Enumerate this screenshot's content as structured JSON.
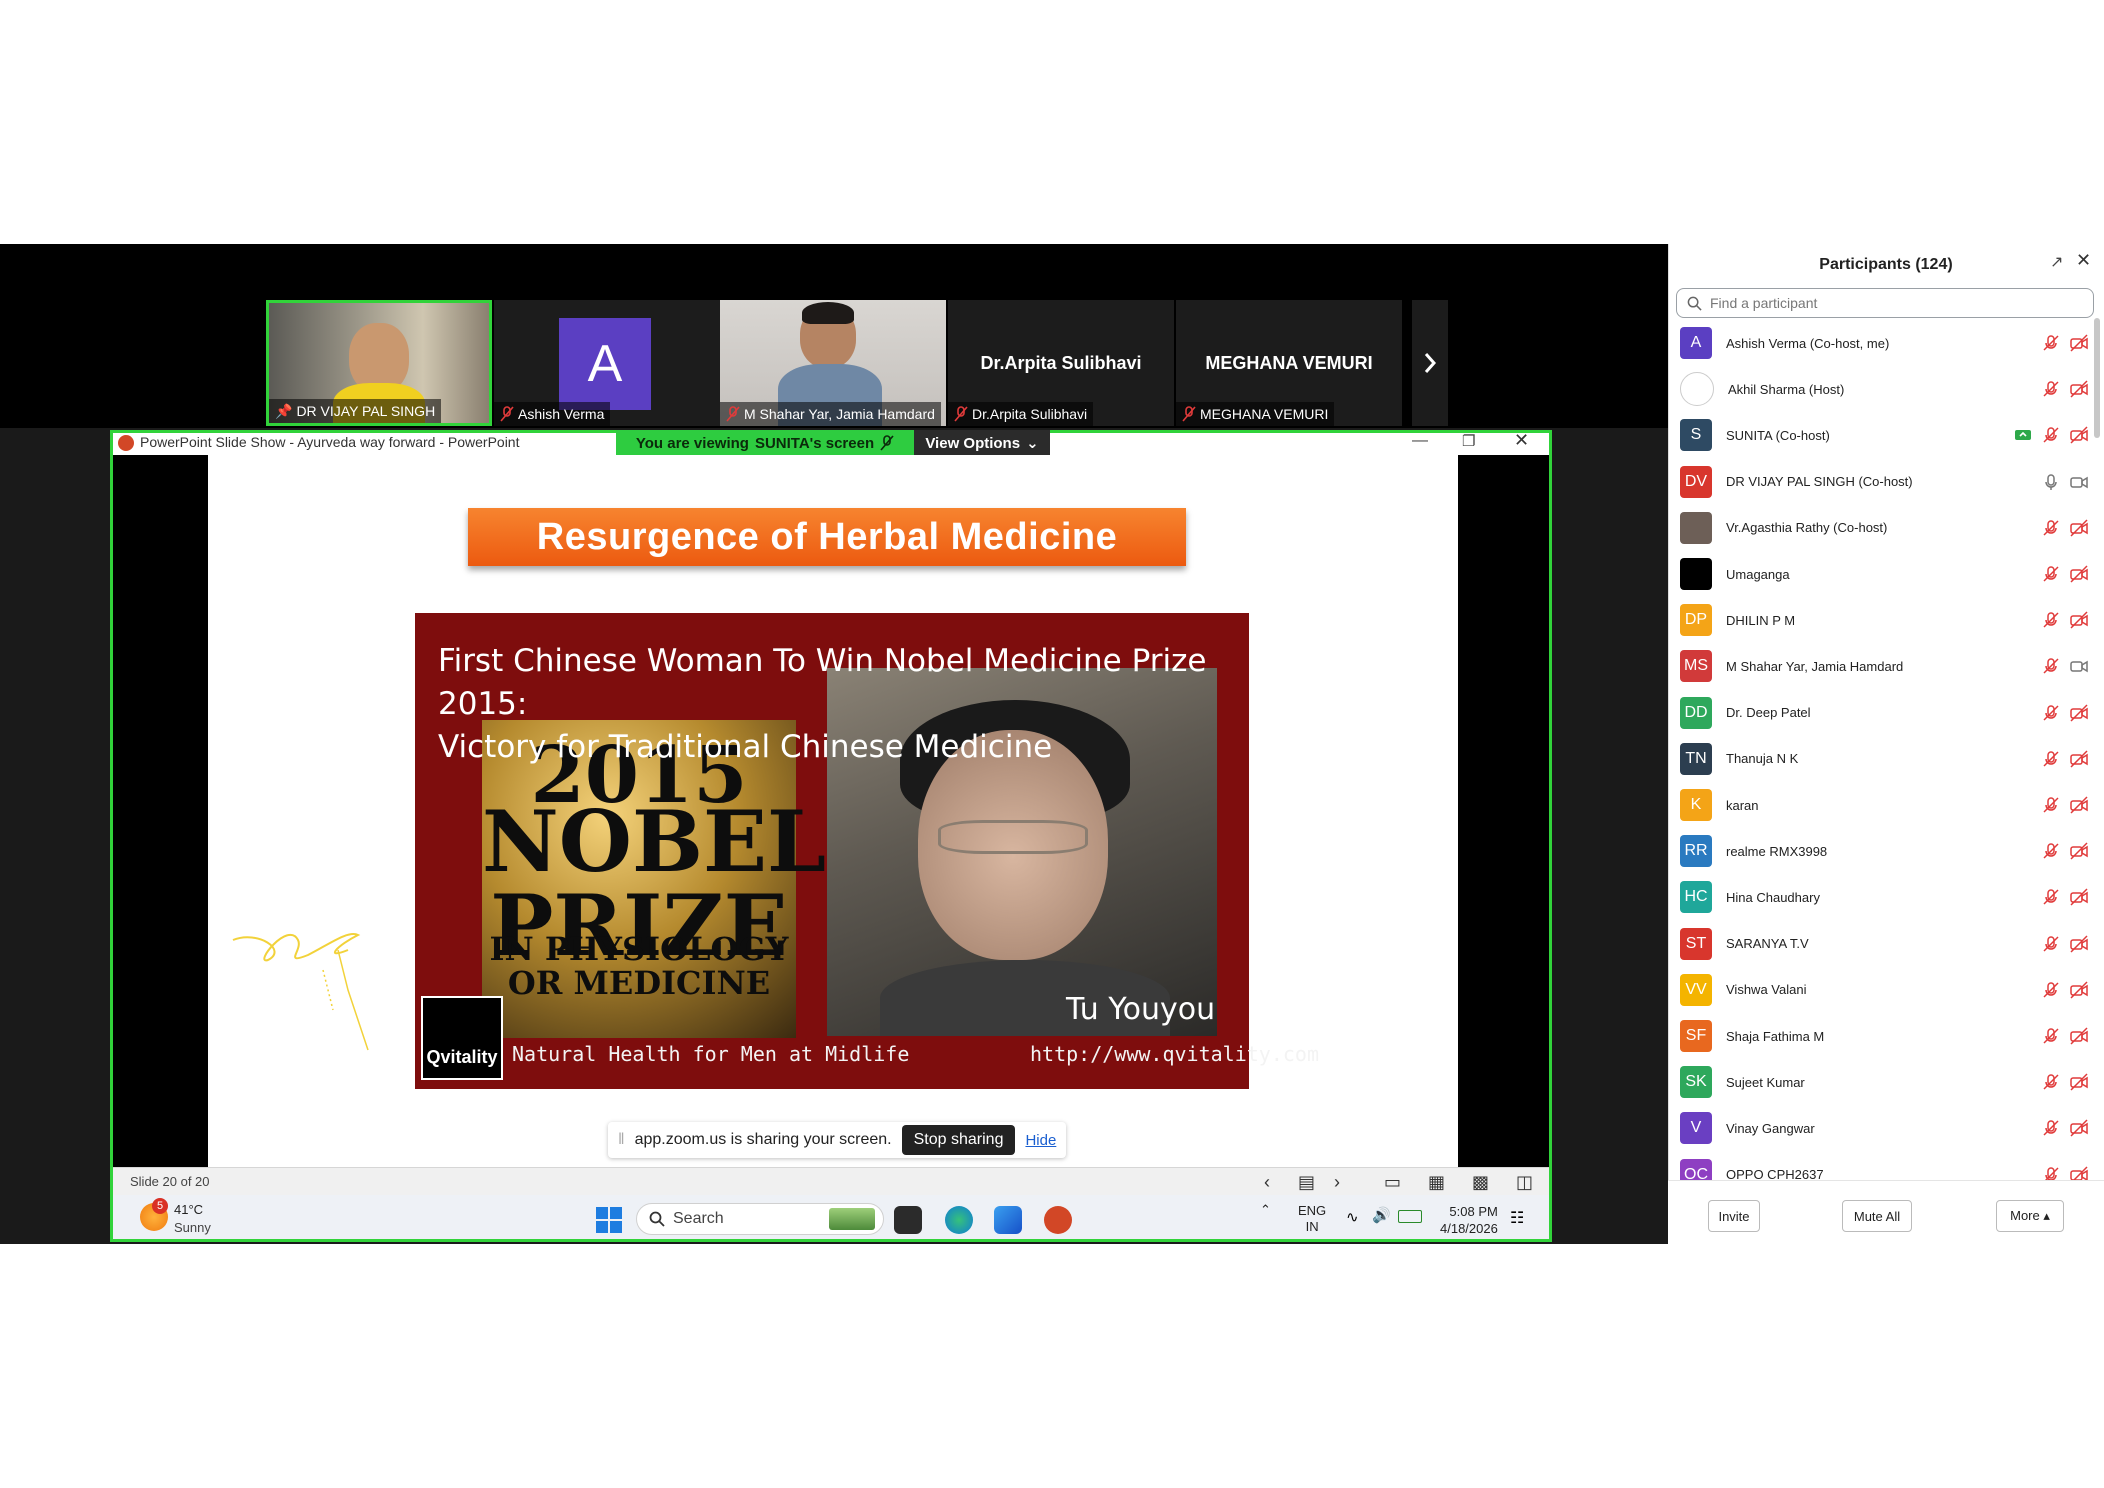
{
  "thumbnails": [
    {
      "name": "DR VIJAY PAL SINGH",
      "pinned": true
    },
    {
      "name": "Ashish Verma",
      "initial": "A",
      "muted": true
    },
    {
      "name": "M Shahar Yar, Jamia Hamdard",
      "muted": true
    },
    {
      "name": "Dr.Arpita Sulibhavi",
      "muted": true,
      "display": "Dr.Arpita Sulibhavi"
    },
    {
      "name": "MEGHANA VEMURI",
      "muted": true,
      "display": "MEGHANA VEMURI"
    }
  ],
  "share": {
    "app_title": "PowerPoint Slide Show  -  Ayurveda way forward - PowerPoint",
    "viewing_prefix": "You are viewing",
    "viewing_name": "SUNITA's screen",
    "view_options": "View Options",
    "notice_text": "app.zoom.us is sharing your screen.",
    "stop_sharing": "Stop sharing",
    "hide": "Hide"
  },
  "slide": {
    "heading": "Resurgence of Herbal Medicine",
    "caption_line1": "First Chinese Woman To Win Nobel Medicine Prize 2015:",
    "caption_line2": "Victory for Traditional Chinese Medicine",
    "nobel_year": "2015",
    "nobel_line1": "NOBEL",
    "nobel_line2": "PRIZE",
    "nobel_sub1": "IN PHYSIOLOGY",
    "nobel_sub2": "OR MEDICINE",
    "person_name": "Tu Youyou",
    "logo_text": "Qvitality",
    "tagline": "Natural Health for Men at Midlife",
    "url": "http://www.qvitality.com"
  },
  "statusbar": {
    "slide_count": "Slide 20 of 20"
  },
  "taskbar": {
    "weather_badge": "5",
    "temperature": "41°C",
    "condition": "Sunny",
    "search_label": "Search",
    "lang_line1": "ENG",
    "lang_line2": "IN",
    "time": "5:08 PM",
    "date": "4/18/2026"
  },
  "panel": {
    "title": "Participants (124)",
    "search_placeholder": "Find a participant",
    "invite": "Invite",
    "mute_all": "Mute All",
    "more": "More ▴"
  },
  "participants": [
    {
      "name": "Ashish Verma (Co-host, me)",
      "initials": "A",
      "color": "#5b3fc2",
      "mic": "off",
      "video": "off"
    },
    {
      "name": "Akhil Sharma (Host)",
      "initials": "",
      "color": "#ffffff",
      "mic": "off",
      "video": "off"
    },
    {
      "name": "SUNITA (Co-host)",
      "initials": "S",
      "color": "#2e4a63",
      "mic": "off",
      "video": "off",
      "sharing": true
    },
    {
      "name": "DR VIJAY PAL SINGH (Co-host)",
      "initials": "DV",
      "color": "#d8362d",
      "mic": "on",
      "video": "on"
    },
    {
      "name": "Vr.Agasthia Rathy (Co-host)",
      "initials": "",
      "color": "#6d5f57",
      "mic": "off",
      "video": "off"
    },
    {
      "name": "Umaganga",
      "initials": "",
      "color": "#000000",
      "mic": "off",
      "video": "off"
    },
    {
      "name": "DHILIN P M",
      "initials": "DP",
      "color": "#f4a417",
      "mic": "off",
      "video": "off"
    },
    {
      "name": "M Shahar Yar, Jamia Hamdard",
      "initials": "MS",
      "color": "#d13a3a",
      "mic": "off",
      "video": "on"
    },
    {
      "name": "Dr. Deep Patel",
      "initials": "DD",
      "color": "#2ea85c",
      "mic": "off",
      "video": "off"
    },
    {
      "name": "Thanuja N K",
      "initials": "TN",
      "color": "#2c3e50",
      "mic": "off",
      "video": "off"
    },
    {
      "name": "karan",
      "initials": "K",
      "color": "#f4a417",
      "mic": "off",
      "video": "off"
    },
    {
      "name": "realme RMX3998",
      "initials": "RR",
      "color": "#2a7ac0",
      "mic": "off",
      "video": "off"
    },
    {
      "name": "Hina Chaudhary",
      "initials": "HC",
      "color": "#1fa79a",
      "mic": "off",
      "video": "off"
    },
    {
      "name": "SARANYA T.V",
      "initials": "ST",
      "color": "#d8362d",
      "mic": "off",
      "video": "off"
    },
    {
      "name": "Vishwa Valani",
      "initials": "VV",
      "color": "#f4b400",
      "mic": "off",
      "video": "off"
    },
    {
      "name": "Shaja Fathima M",
      "initials": "SF",
      "color": "#e8681f",
      "mic": "off",
      "video": "off"
    },
    {
      "name": "Sujeet Kumar",
      "initials": "SK",
      "color": "#2ea85c",
      "mic": "off",
      "video": "off"
    },
    {
      "name": "Vinay Gangwar",
      "initials": "V",
      "color": "#6a3fc2",
      "mic": "off",
      "video": "off"
    },
    {
      "name": "OPPO CPH2637",
      "initials": "OC",
      "color": "#8e3fc2",
      "mic": "off",
      "video": "off"
    }
  ]
}
